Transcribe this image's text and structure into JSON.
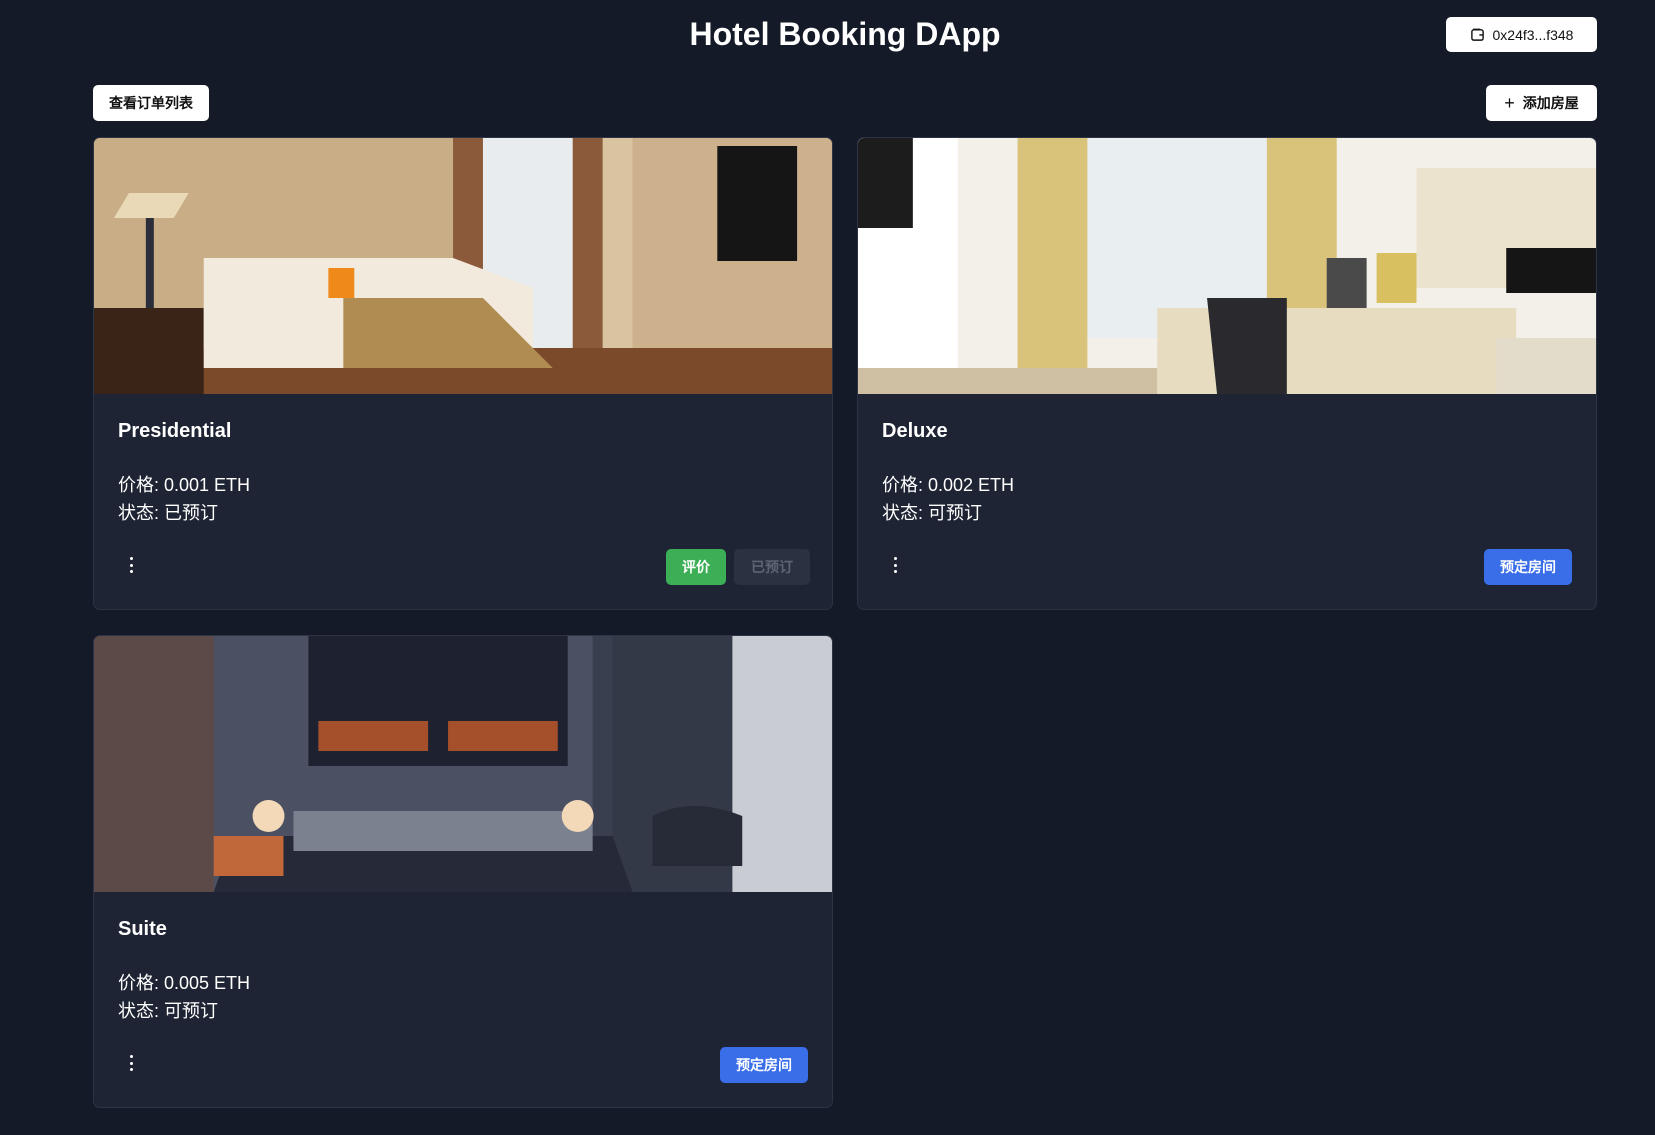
{
  "header": {
    "title": "Hotel Booking DApp",
    "wallet_address": "0x24f3...f348"
  },
  "toolbar": {
    "orders_label": "查看订单列表",
    "add_room_label": "添加房屋"
  },
  "rooms": [
    {
      "name": "Presidential",
      "price": "价格: 0.001 ETH",
      "status": "状态: 已预订",
      "review_label": "评价",
      "booked_label": "已预订"
    },
    {
      "name": "Deluxe",
      "price": "价格: 0.002 ETH",
      "status": "状态: 可预订",
      "book_label": "预定房间"
    },
    {
      "name": "Suite",
      "price": "价格: 0.005 ETH",
      "status": "状态: 可预订",
      "book_label": "预定房间"
    }
  ],
  "icons": {
    "wallet": "wallet-icon",
    "plus": "plus-icon",
    "more": "more-vertical-icon"
  },
  "colors": {
    "background": "#141a27",
    "card": "#1e2433",
    "review_button": "#3cae55",
    "book_button": "#3a6ee8",
    "disabled_button": "#2b3140"
  }
}
